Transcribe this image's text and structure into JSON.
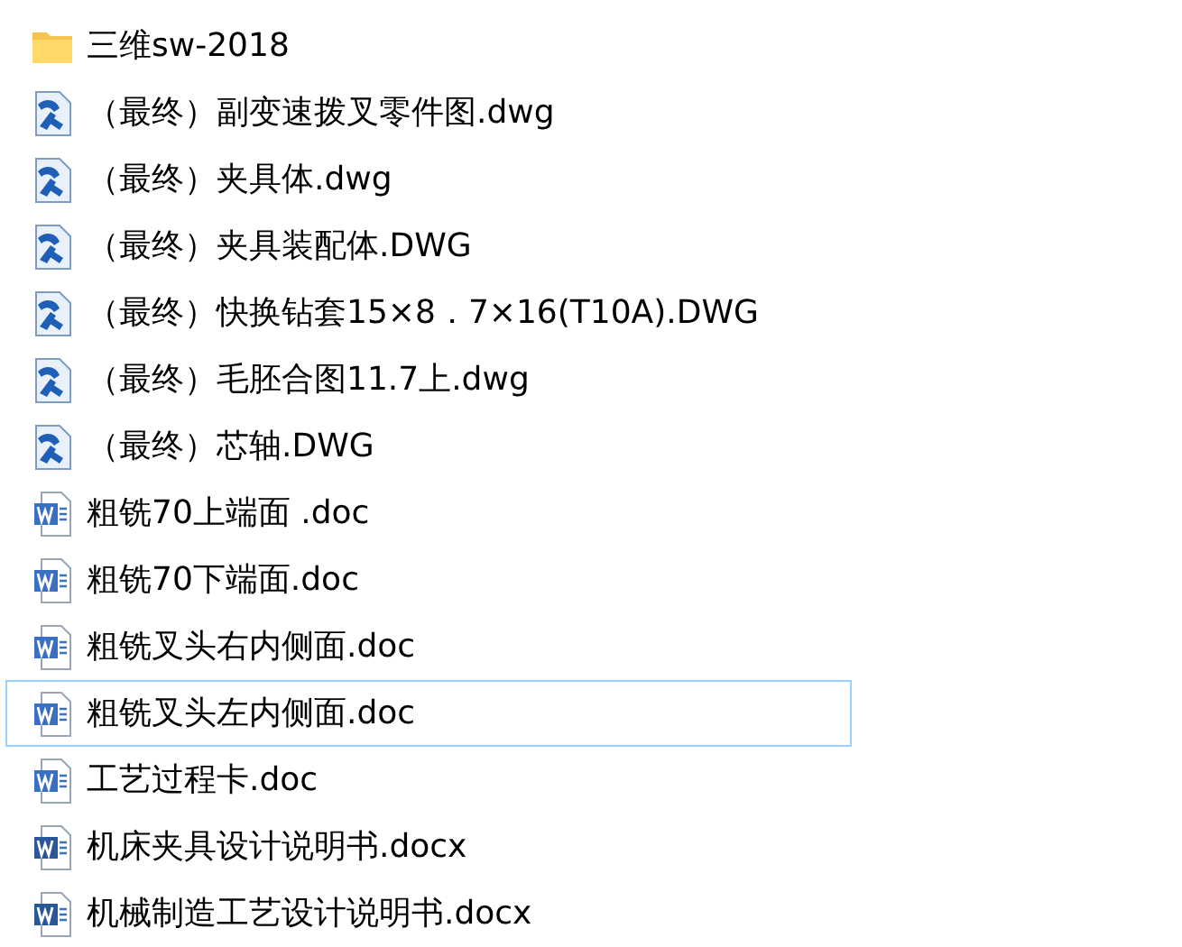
{
  "files": [
    {
      "name": "三维sw-2018",
      "kind": "folder",
      "focused": false
    },
    {
      "name": "（最终）副变速拨叉零件图.dwg",
      "kind": "dwg",
      "focused": false
    },
    {
      "name": "（最终）夹具体.dwg",
      "kind": "dwg",
      "focused": false
    },
    {
      "name": "（最终）夹具装配体.DWG",
      "kind": "dwg",
      "focused": false
    },
    {
      "name": "（最终）快换钻套15×8．7×16(T10A).DWG",
      "kind": "dwg",
      "focused": false
    },
    {
      "name": "（最终）毛胚合图11.7上.dwg",
      "kind": "dwg",
      "focused": false
    },
    {
      "name": "（最终）芯轴.DWG",
      "kind": "dwg",
      "focused": false
    },
    {
      "name": "粗铣70上端面 .doc",
      "kind": "doc",
      "focused": false
    },
    {
      "name": "粗铣70下端面.doc",
      "kind": "doc",
      "focused": false
    },
    {
      "name": "粗铣叉头右内侧面.doc",
      "kind": "doc",
      "focused": false
    },
    {
      "name": "粗铣叉头左内侧面.doc",
      "kind": "doc",
      "focused": true
    },
    {
      "name": "工艺过程卡.doc",
      "kind": "doc",
      "focused": false
    },
    {
      "name": "机床夹具设计说明书.docx",
      "kind": "docx",
      "focused": false
    },
    {
      "name": "机械制造工艺设计说明书.docx",
      "kind": "docx",
      "focused": false
    }
  ]
}
